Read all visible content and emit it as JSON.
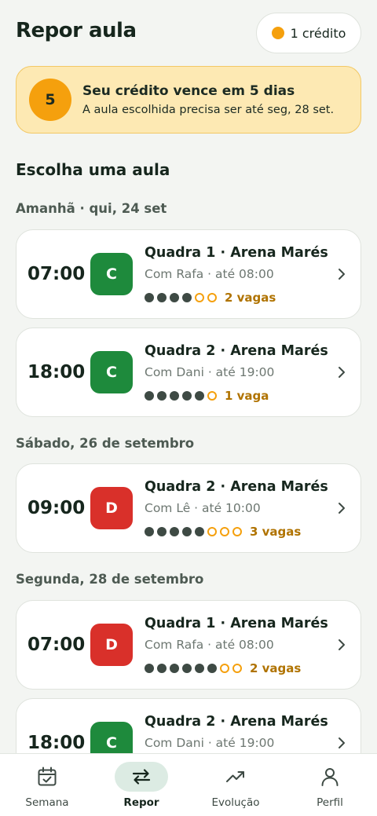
{
  "header": {
    "title": "Repor aula",
    "credit_label": "1 crédito"
  },
  "banner": {
    "days": "5",
    "title": "Seu crédito vence em 5 dias",
    "subtitle": "A aula escolhida precisa ser até seg, 28 set."
  },
  "section_title": "Escolha uma aula",
  "days": [
    {
      "label": "Amanhã · qui, 24 set"
    },
    {
      "label": "Sábado, 26 de setembro"
    },
    {
      "label": "Segunda, 28 de setembro"
    }
  ],
  "classes": [
    {
      "time": "07:00",
      "level": "C",
      "court": "Quadra 1 · Arena Marés",
      "coach": "Com Rafa · até 08:00",
      "filled": 4,
      "total": 6,
      "spots": "2 vagas"
    },
    {
      "time": "18:00",
      "level": "C",
      "court": "Quadra 2 · Arena Marés",
      "coach": "Com Dani · até 19:00",
      "filled": 5,
      "total": 6,
      "spots": "1 vaga"
    },
    {
      "time": "09:00",
      "level": "D",
      "court": "Quadra 2 · Arena Marés",
      "coach": "Com Lê · até 10:00",
      "filled": 5,
      "total": 8,
      "spots": "3 vagas"
    },
    {
      "time": "07:00",
      "level": "D",
      "court": "Quadra 1 · Arena Marés",
      "coach": "Com Rafa · até 08:00",
      "filled": 6,
      "total": 8,
      "spots": "2 vagas"
    },
    {
      "time": "18:00",
      "level": "C",
      "court": "Quadra 2 · Arena Marés",
      "coach": "Com Dani · até 19:00",
      "filled": 0,
      "total": 0,
      "spots": ""
    }
  ],
  "nav": [
    {
      "label": "Semana",
      "icon": "calendar-check-icon",
      "active": false
    },
    {
      "label": "Repor",
      "icon": "swap-arrows-icon",
      "active": true
    },
    {
      "label": "Evolução",
      "icon": "trending-up-icon",
      "active": false
    },
    {
      "label": "Perfil",
      "icon": "person-icon",
      "active": false
    }
  ],
  "colors": {
    "accent": "#f5a00d",
    "level_C": "#1e8a3c",
    "level_D": "#d9302a",
    "banner_bg": "#fde9b3",
    "active_nav_bg": "#dcebe3"
  }
}
